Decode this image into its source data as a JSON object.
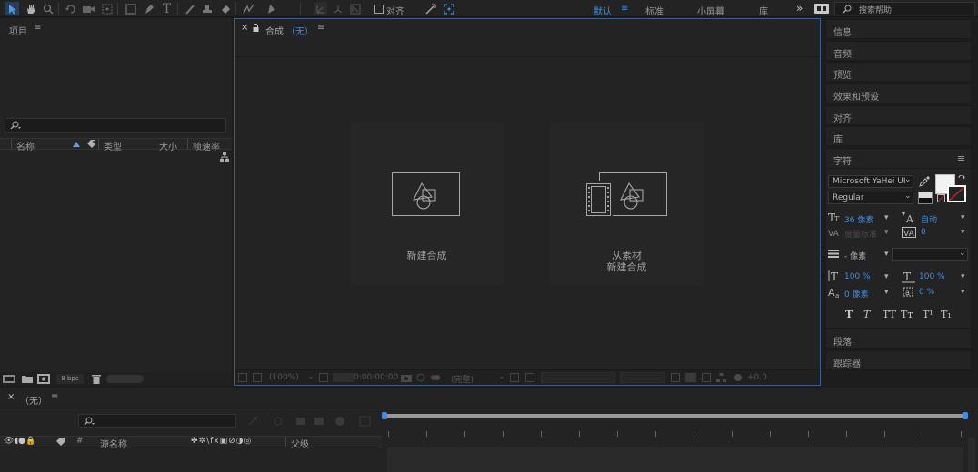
{
  "toolbar": {
    "align_label": "对齐",
    "workspaces": [
      "默认",
      "标准",
      "小屏幕",
      "库"
    ],
    "workspace_menu_icon": "≡",
    "more_icon": "»",
    "search_placeholder": "搜索帮助"
  },
  "project": {
    "title": "项目",
    "menu_icon": "≡",
    "search_placeholder": "",
    "columns": [
      "名称",
      "类型",
      "大小",
      "帧速率"
    ],
    "bpc": "8 bpc"
  },
  "composition": {
    "tab_label": "合成",
    "tab_value": "（无）",
    "menu_icon": "≡",
    "cards": [
      {
        "line1": "新建合成",
        "line2": ""
      },
      {
        "line1": "从素材",
        "line2": "新建合成"
      }
    ],
    "footer": {
      "zoom": "(100%)",
      "timecode": "0:00:00:00",
      "quality": "(完整)",
      "exposure": "+0.0"
    }
  },
  "right_panels": {
    "info": "信息",
    "audio": "音频",
    "preview": "预览",
    "effects": "效果和预设",
    "align": "对齐",
    "library": "库",
    "character": "字符",
    "paragraph": "段落",
    "tracker": "跟踪器"
  },
  "character": {
    "menu_icon": "≡",
    "font_family": "Microsoft YaHei UI",
    "font_style": "Regular",
    "font_size": "36 像素",
    "leading": "自动",
    "kerning": "度量标准",
    "tracking": "0",
    "stroke_width": "- 像素",
    "vertical_scale": "100 %",
    "horizontal_scale": "100 %",
    "baseline_shift": "0 像素",
    "tsume": "0 %",
    "style_buttons": [
      "T",
      "T",
      "TT",
      "Tт",
      "T¹",
      "T₁"
    ],
    "fill_color": "#f2f2f2",
    "stroke_color": "#ffffff"
  },
  "timeline": {
    "close_icon": "×",
    "tab_label": "（无）",
    "menu_icon": "≡",
    "search_placeholder": "",
    "columns": [
      "源名称",
      "父级"
    ],
    "hash": "#"
  },
  "colors": {
    "accent": "#3d8ee6",
    "panel_bg": "#232323",
    "app_bg": "#1d1d1d"
  }
}
